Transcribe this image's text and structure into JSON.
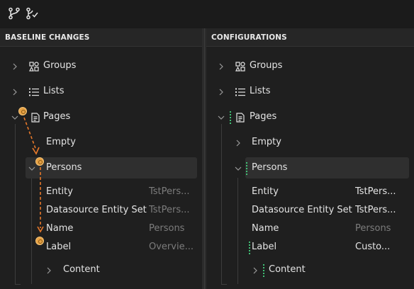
{
  "toolbar": {
    "buttons": [
      {
        "icon": "branch-icon"
      },
      {
        "icon": "branch-check-icon"
      }
    ]
  },
  "left_panel": {
    "title": "BASELINE CHANGES",
    "tree": {
      "groups": "Groups",
      "lists": "Lists",
      "pages": "Pages",
      "empty": "Empty",
      "persons": "Persons",
      "props": [
        {
          "name": "Entity",
          "value": "TstPers..."
        },
        {
          "name": "Datasource Entity Set",
          "value": "TstPers..."
        },
        {
          "name": "Name",
          "value": "Persons"
        },
        {
          "name": "Label",
          "value": "Overvie..."
        }
      ],
      "content": "Content"
    }
  },
  "right_panel": {
    "title": "CONFIGURATIONS",
    "tree": {
      "groups": "Groups",
      "lists": "Lists",
      "pages": "Pages",
      "empty": "Empty",
      "persons": "Persons",
      "props": [
        {
          "name": "Entity",
          "value": "TstPers..."
        },
        {
          "name": "Datasource Entity Set",
          "value": "TstPers..."
        },
        {
          "name": "Name",
          "value": "Persons"
        },
        {
          "name": "Label",
          "value": "Custo..."
        }
      ],
      "content": "Content"
    }
  },
  "colors": {
    "change_marker": "#e7a245",
    "change_arrow": "#e8792a",
    "config_indicator": "#3fbf74"
  }
}
